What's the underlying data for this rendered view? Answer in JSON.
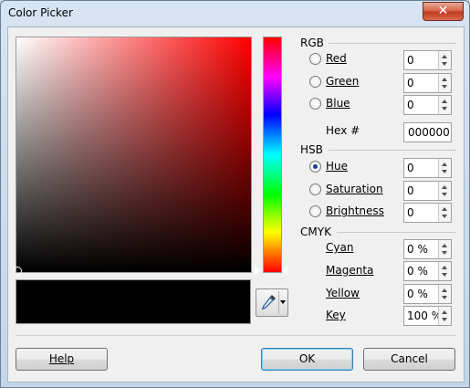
{
  "window": {
    "title": "Color Picker",
    "close_glyph": "✕"
  },
  "rgb": {
    "group_label": "RGB",
    "red": {
      "label": "Red",
      "value": "0"
    },
    "green": {
      "label": "Green",
      "value": "0"
    },
    "blue": {
      "label": "Blue",
      "value": "0"
    },
    "hex_label": "Hex #",
    "hex_value": "000000"
  },
  "hsb": {
    "group_label": "HSB",
    "hue": {
      "label": "Hue",
      "value": "0",
      "selected": true
    },
    "saturation": {
      "label": "Saturation",
      "value": "0"
    },
    "brightness": {
      "label": "Brightness",
      "value": "0"
    }
  },
  "cmyk": {
    "group_label": "CMYK",
    "cyan": {
      "label": "Cyan",
      "value": "0 %"
    },
    "magenta": {
      "label": "Magenta",
      "value": "0 %"
    },
    "yellow": {
      "label": "Yellow",
      "value": "0 %"
    },
    "key": {
      "label": "Key",
      "value": "100 %"
    }
  },
  "buttons": {
    "help": "Help",
    "ok": "OK",
    "cancel": "Cancel"
  },
  "colors": {
    "current": "#000000",
    "hue_base": "#ff0000"
  },
  "icons": {
    "pipette": "pipette-icon",
    "close": "close-icon"
  }
}
